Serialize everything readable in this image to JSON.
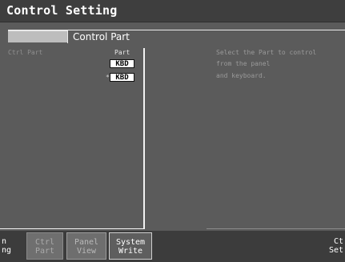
{
  "window": {
    "title": "Control Setting"
  },
  "tabs": {
    "active_label": "Control Part"
  },
  "content": {
    "left_label": "Ctrl Part",
    "column_header": "Part",
    "row_marker": "*",
    "values": [
      "KBD",
      "KBD"
    ],
    "info_lines": [
      "Select the Part to control",
      "from the panel",
      "and keyboard."
    ]
  },
  "function_bar": {
    "left": {
      "line1": "n",
      "line2": "ng"
    },
    "ctrl_part": {
      "line1": "Ctrl",
      "line2": "Part"
    },
    "panel_view": {
      "line1": "Panel",
      "line2": "View"
    },
    "system_write": {
      "line1": "System",
      "line2": "Write"
    },
    "right": {
      "line1": "Ct",
      "line2": "Set"
    }
  }
}
